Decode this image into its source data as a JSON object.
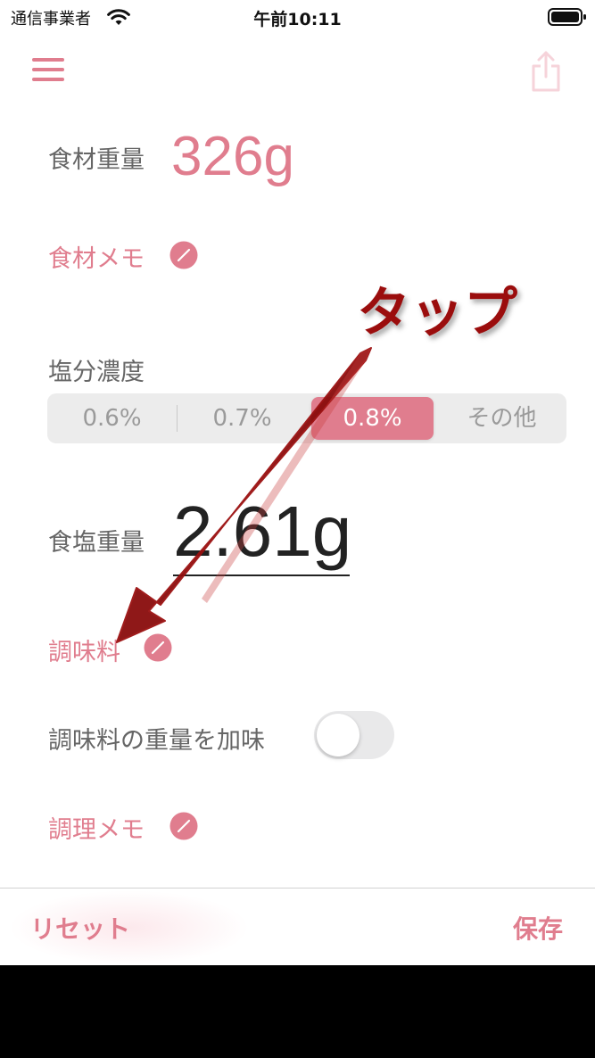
{
  "status_bar": {
    "carrier": "通信事業者",
    "time": "午前10:11"
  },
  "ingredient": {
    "weight_label": "食材重量",
    "weight_value": "326g",
    "memo_label": "食材メモ"
  },
  "salt": {
    "concentration_label": "塩分濃度",
    "options": [
      "0.6%",
      "0.7%",
      "0.8%",
      "その他"
    ],
    "selected": "0.8%",
    "weight_label": "食塩重量",
    "weight_value": "2.61g"
  },
  "seasoning": {
    "label": "調味料",
    "include_weight_label": "調味料の重量を加味",
    "include_weight_on": false
  },
  "cooking_memo": {
    "label": "調理メモ"
  },
  "bottom_bar": {
    "reset_label": "リセット",
    "save_label": "保存"
  },
  "annotation": {
    "text": "タップ"
  },
  "colors": {
    "accent": "#e07d8e",
    "annotation": "#9b0d0d"
  },
  "icons": [
    "wifi-icon",
    "battery-icon",
    "menu-icon",
    "share-icon",
    "edit-icon"
  ]
}
